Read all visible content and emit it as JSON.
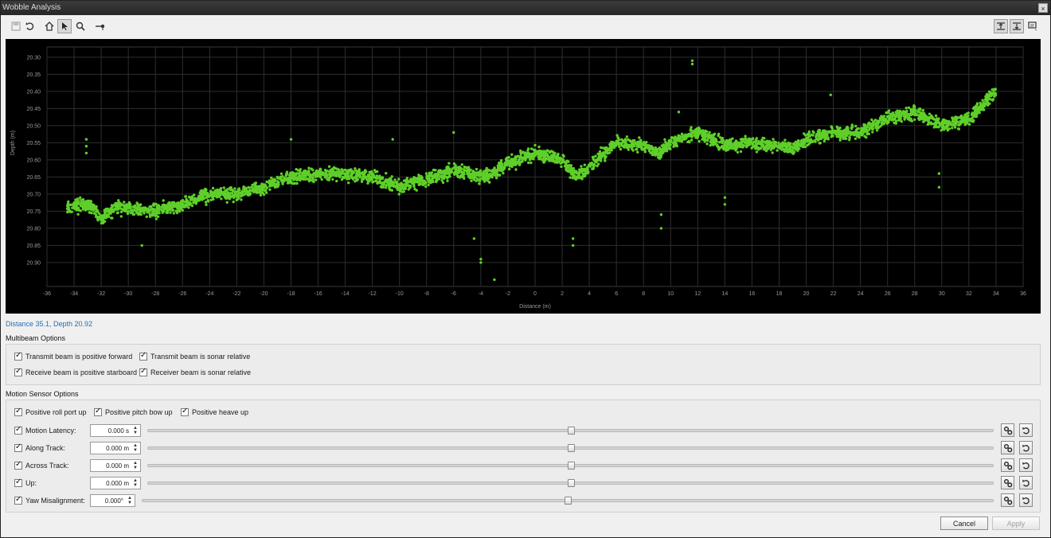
{
  "window": {
    "title": "Wobble Analysis",
    "close_glyph": "×"
  },
  "toolbar": {
    "left_icons": [
      "save-icon",
      "undo-icon",
      "home-icon",
      "pointer-icon",
      "zoom-icon",
      "pin-icon"
    ],
    "right_icons": [
      "align-up-icon",
      "align-down-icon",
      "display-options-icon"
    ]
  },
  "chart_data": {
    "type": "scatter",
    "title": "",
    "xlabel": "Distance (m)",
    "ylabel": "Depth (m)",
    "xlim": [
      -36,
      36
    ],
    "ylim": [
      20.97,
      20.27
    ],
    "y_inverted": true,
    "x_ticks": [
      -36,
      -34,
      -32,
      -30,
      -28,
      -26,
      -24,
      -22,
      -20,
      -18,
      -16,
      -14,
      -12,
      -10,
      -8,
      -6,
      -4,
      -2,
      0,
      2,
      4,
      6,
      8,
      10,
      12,
      14,
      16,
      18,
      20,
      22,
      24,
      26,
      28,
      30,
      32,
      34,
      36
    ],
    "y_ticks": [
      "20.30",
      "20.35",
      "20.40",
      "20.45",
      "20.50",
      "20.55",
      "20.60",
      "20.65",
      "20.70",
      "20.75",
      "20.80",
      "20.85",
      "20.90"
    ],
    "grid": true,
    "background": "#000000",
    "point_color": "#5fcf2a",
    "trend_x": [
      -34.5,
      -33,
      -32,
      -31,
      -30,
      -28,
      -26,
      -24,
      -22,
      -20,
      -18,
      -16,
      -14,
      -12,
      -10,
      -8,
      -6,
      -4,
      -3,
      -2,
      0,
      1,
      2,
      3,
      4,
      6,
      8,
      9,
      10,
      12,
      14,
      16,
      18,
      19,
      20,
      22,
      24,
      26,
      28,
      30,
      32,
      34
    ],
    "trend_y": [
      20.74,
      20.73,
      20.77,
      20.74,
      20.74,
      20.75,
      20.73,
      20.7,
      20.7,
      20.68,
      20.65,
      20.64,
      20.64,
      20.65,
      20.68,
      20.66,
      20.63,
      20.65,
      20.64,
      20.61,
      20.58,
      20.59,
      20.6,
      20.65,
      20.62,
      20.55,
      20.56,
      20.58,
      20.55,
      20.52,
      20.56,
      20.55,
      20.56,
      20.57,
      20.54,
      20.52,
      20.52,
      20.48,
      20.46,
      20.5,
      20.48,
      20.4
    ],
    "outliers": [
      [
        -33.1,
        20.54
      ],
      [
        -33.1,
        20.56
      ],
      [
        -33.1,
        20.58
      ],
      [
        -18,
        20.54
      ],
      [
        -29,
        20.85
      ],
      [
        -4,
        20.89
      ],
      [
        -4,
        20.9
      ],
      [
        -3,
        20.95
      ],
      [
        -4.5,
        20.83
      ],
      [
        2.8,
        20.83
      ],
      [
        2.8,
        20.85
      ],
      [
        11.6,
        20.31
      ],
      [
        11.6,
        20.32
      ],
      [
        9.3,
        20.76
      ],
      [
        9.3,
        20.8
      ],
      [
        14,
        20.71
      ],
      [
        14,
        20.73
      ],
      [
        21.8,
        20.41
      ],
      [
        29.8,
        20.64
      ],
      [
        29.8,
        20.68
      ],
      [
        -6,
        20.52
      ],
      [
        -10.5,
        20.54
      ],
      [
        10.6,
        20.46
      ]
    ]
  },
  "status": "Distance 35.1, Depth 20.92",
  "multibeam": {
    "title": "Multibeam Options",
    "options": [
      {
        "label": "Transmit beam is positive forward",
        "checked": true
      },
      {
        "label": "Transmit beam is sonar relative",
        "checked": true
      },
      {
        "label": "Receive beam is positive starboard",
        "checked": true
      },
      {
        "label": "Receiver beam is sonar relative",
        "checked": true
      }
    ]
  },
  "motion": {
    "title": "Motion Sensor Options",
    "options": [
      {
        "label": "Positive roll port up",
        "checked": true
      },
      {
        "label": "Positive pitch bow up",
        "checked": true
      },
      {
        "label": "Positive heave up",
        "checked": true
      }
    ],
    "rows": [
      {
        "label": "Motion Latency:",
        "value": "0.000 s",
        "slider": 0.5
      },
      {
        "label": "Along Track:",
        "value": "0.000 m",
        "slider": 0.5
      },
      {
        "label": "Across Track:",
        "value": "0.000 m",
        "slider": 0.5
      },
      {
        "label": "Up:",
        "value": "0.000 m",
        "slider": 0.5
      },
      {
        "label": "Yaw Misalignment:",
        "value": "0.000°",
        "slider": 0.5
      }
    ]
  },
  "buttons": {
    "cancel": "Cancel",
    "apply": "Apply"
  }
}
